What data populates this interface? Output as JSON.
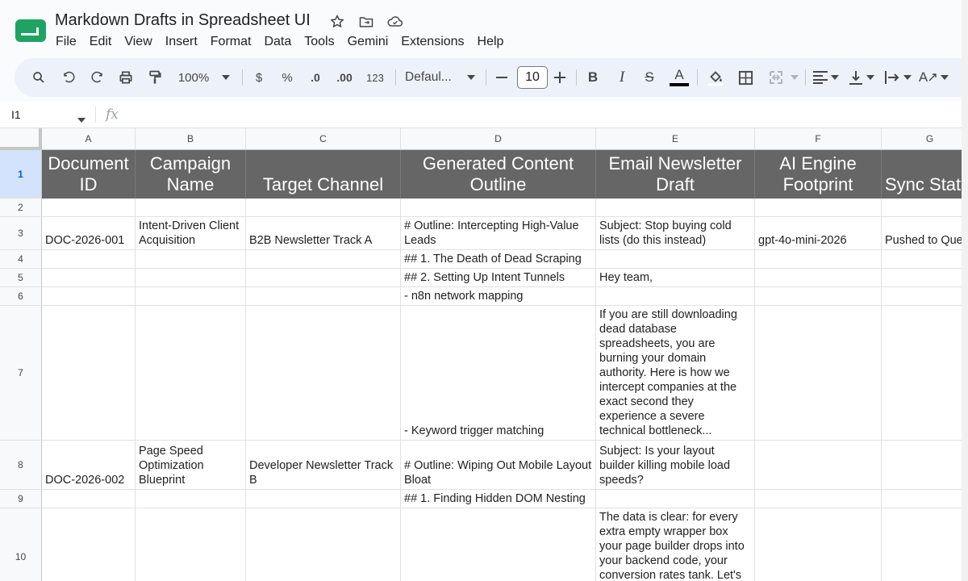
{
  "title_bar": {
    "doc_title": "Markdown Drafts in Spreadsheet UI",
    "icons": [
      "star-icon",
      "move-to-folder-icon",
      "cloud-status-icon"
    ]
  },
  "menu": [
    "File",
    "Edit",
    "View",
    "Insert",
    "Format",
    "Data",
    "Tools",
    "Gemini",
    "Extensions",
    "Help"
  ],
  "toolbar": {
    "zoom": "100%",
    "currency_label": "$",
    "percent_label": "%",
    "decrease_decimal_label": ".0",
    "increase_decimal_label": ".00",
    "more_formats_label": "123",
    "font_name": "Defaul...",
    "font_size": "10",
    "bold_label": "B",
    "italic_label": "I",
    "strike_label": "S",
    "text_color_label": "A",
    "text_rotation_label": "A"
  },
  "formula_bar": {
    "name_box": "I1",
    "fx_label": "fx",
    "value": ""
  },
  "columns": [
    "A",
    "B",
    "C",
    "D",
    "E",
    "F",
    "G"
  ],
  "rows": [
    "1",
    "2",
    "3",
    "4",
    "5",
    "6",
    "7",
    "8",
    "9",
    "10"
  ],
  "header_row": [
    "Document ID",
    "Campaign Name",
    "Target Channel",
    "Generated Content Outline",
    "Email Newsletter Draft",
    "AI Engine Footprint",
    "Sync Status"
  ],
  "cells": {
    "r3": [
      "DOC-2026-001",
      "Intent-Driven Client Acquisition",
      "B2B Newsletter Track A",
      "# Outline: Intercepting High-Value Leads",
      "Subject: Stop buying cold lists (do this instead)",
      "gpt-4o-mini-2026",
      "Pushed to Queue"
    ],
    "r4": [
      "",
      "",
      "",
      "## 1. The Death of Dead Scraping",
      "",
      "",
      ""
    ],
    "r5": [
      "",
      "",
      "",
      "## 2. Setting Up Intent Tunnels",
      "Hey team,",
      "",
      ""
    ],
    "r6": [
      "",
      "",
      "",
      "- n8n network mapping",
      "",
      "",
      ""
    ],
    "r7": [
      "",
      "",
      "",
      "- Keyword trigger matching",
      "If you are still downloading dead database spreadsheets, you are burning your domain authority. Here is how we intercept companies at the exact second they experience a severe technical bottleneck...",
      "",
      ""
    ],
    "r8": [
      "DOC-2026-002",
      "Page Speed Optimization Blueprint",
      "Developer Newsletter Track B",
      "# Outline: Wiping Out Mobile Layout Bloat",
      "Subject: Is your layout builder killing mobile load speeds?",
      "",
      ""
    ],
    "r9": [
      "",
      "",
      "",
      "## 1. Finding Hidden DOM Nesting",
      "",
      "",
      ""
    ],
    "r10": [
      "",
      "",
      "",
      "",
      "The data is clear: for every extra empty wrapper box your page builder drops into your backend code, your conversion rates tank. Let's",
      "",
      ""
    ]
  },
  "colors": {
    "header_fill": "#666666",
    "header_text": "#ffffff",
    "toolbar_bg": "#edf2fa",
    "selected_row": "#d3e3fd"
  }
}
